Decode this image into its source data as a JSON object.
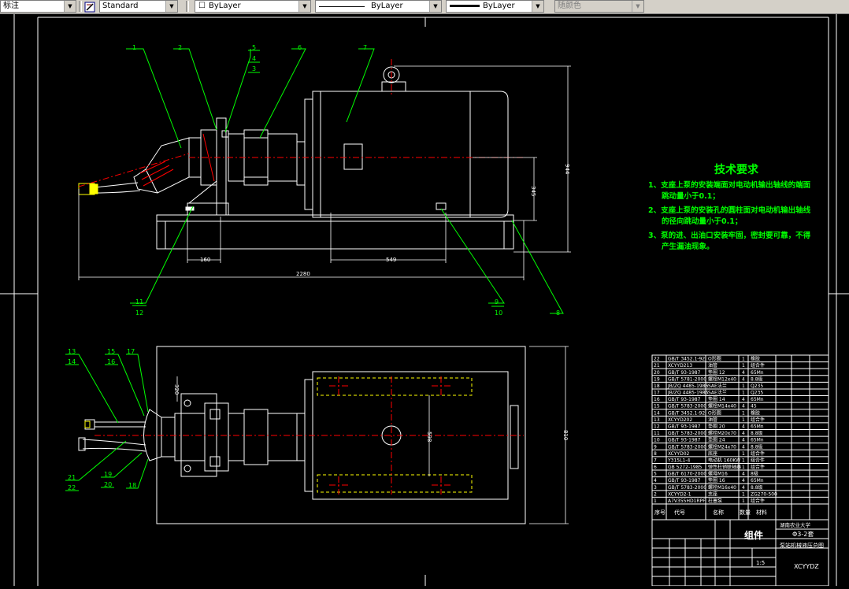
{
  "toolbar": {
    "dim_style": "标注",
    "text_style": "Standard",
    "layer": "ByLayer",
    "linetype": "ByLayer",
    "lineweight": "ByLayer",
    "color": "随颜色"
  },
  "drawing": {
    "tech_req": {
      "title": "技术要求",
      "items": [
        "1、支座上泵的安装端面对电动机输出轴线的端面",
        "跳动量小于0.1；",
        "2、支座上泵的安装孔的圆柱面对电动机输出轴线",
        "的径向跳动量小于0.1；",
        "3、泵的进、出油口安装牢固，密封要可靠，不得",
        "产生漏油现象。"
      ]
    },
    "dimensions": {
      "total_length": "2280",
      "base_left": "160",
      "base_mid": "549",
      "shaft_height": "345",
      "total_height": "944",
      "plan_width": "810",
      "plan_inner": "598",
      "flange": "320"
    },
    "balloons_top": [
      "1",
      "2",
      "5",
      "4",
      "3",
      "6",
      "7",
      "11",
      "12",
      "9",
      "10",
      "8"
    ],
    "balloons_bottom": [
      "13",
      "14",
      "15",
      "16",
      "17",
      "21",
      "22",
      "19",
      "20",
      "18"
    ],
    "title_block": {
      "assembly": "组件",
      "name_top": "Φ3-2套",
      "drawing_name": "泵站机械液压总图",
      "code": "XCYYDZ",
      "school": "湖南农业大学",
      "scale": "1:5",
      "header_seq": "序号",
      "header_code": "代号",
      "header_name": "名称",
      "header_qty": "数量",
      "header_mat": "材料"
    },
    "bom": [
      {
        "no": "22",
        "code": "GB/T 3452.1-92",
        "name": "O形圈",
        "qty": "1",
        "mat": "橡胶"
      },
      {
        "no": "21",
        "code": "XCYYD213",
        "name": "油管",
        "qty": "1",
        "mat": "组合件"
      },
      {
        "no": "20",
        "code": "GB/T 93-1987",
        "name": "垫圈 12",
        "qty": "4",
        "mat": "65Mn"
      },
      {
        "no": "19",
        "code": "GB/T 5781-2000",
        "name": "螺栓M12x40",
        "qty": "4",
        "mat": "8.8级"
      },
      {
        "no": "18",
        "code": "JB/ZQ 4485-1986",
        "name": "SAE法兰",
        "qty": "1",
        "mat": "Q235"
      },
      {
        "no": "17",
        "code": "JB/ZQ 4485-1986",
        "name": "SAE法兰",
        "qty": "1",
        "mat": "Q235"
      },
      {
        "no": "16",
        "code": "GB/T 93-1987",
        "name": "垫圈 14",
        "qty": "4",
        "mat": "65Mn"
      },
      {
        "no": "15",
        "code": "GB/T 5783-2000",
        "name": "螺栓M14x40",
        "qty": "4",
        "mat": "45"
      },
      {
        "no": "14",
        "code": "GB/T 3452.1-92",
        "name": "O形圈",
        "qty": "1",
        "mat": "橡胶"
      },
      {
        "no": "13",
        "code": "XCYYD202",
        "name": "油管",
        "qty": "1",
        "mat": "组合件"
      },
      {
        "no": "12",
        "code": "GB/T 93-1987",
        "name": "垫圈 20",
        "qty": "4",
        "mat": "65Mn"
      },
      {
        "no": "11",
        "code": "GB/T 5783-2000",
        "name": "螺栓M20x70",
        "qty": "4",
        "mat": "8.8级"
      },
      {
        "no": "10",
        "code": "GB/T 93-1987",
        "name": "垫圈 24",
        "qty": "4",
        "mat": "65Mn"
      },
      {
        "no": "9",
        "code": "GB/T 5783-2000",
        "name": "螺栓M24x70",
        "qty": "4",
        "mat": "8.8级"
      },
      {
        "no": "8",
        "code": "XCYYD02",
        "name": "底座",
        "qty": "1",
        "mat": "组合件"
      },
      {
        "no": "7",
        "code": "Y315L1-4",
        "name": "电动机 160KW",
        "qty": "1",
        "mat": "组合件"
      },
      {
        "no": "6",
        "code": "GB 5272-1985",
        "name": "弹性柱销联轴器",
        "qty": "1",
        "mat": "组合件"
      },
      {
        "no": "5",
        "code": "GB/T 6170-2000",
        "name": "螺母M16",
        "qty": "4",
        "mat": "8级"
      },
      {
        "no": "4",
        "code": "GB/T 93-1987",
        "name": "垫圈 16",
        "qty": "4",
        "mat": "65Mn"
      },
      {
        "no": "3",
        "code": "GB/T 5783-2000",
        "name": "螺栓M16x40",
        "qty": "4",
        "mat": "8.8级"
      },
      {
        "no": "2",
        "code": "XCYYD2-1",
        "name": "支座",
        "qty": "1",
        "mat": "ZG270-500"
      },
      {
        "no": "1",
        "code": "A7V355HD1RPF",
        "name": "柱塞泵",
        "qty": "1",
        "mat": "组合件"
      }
    ]
  }
}
